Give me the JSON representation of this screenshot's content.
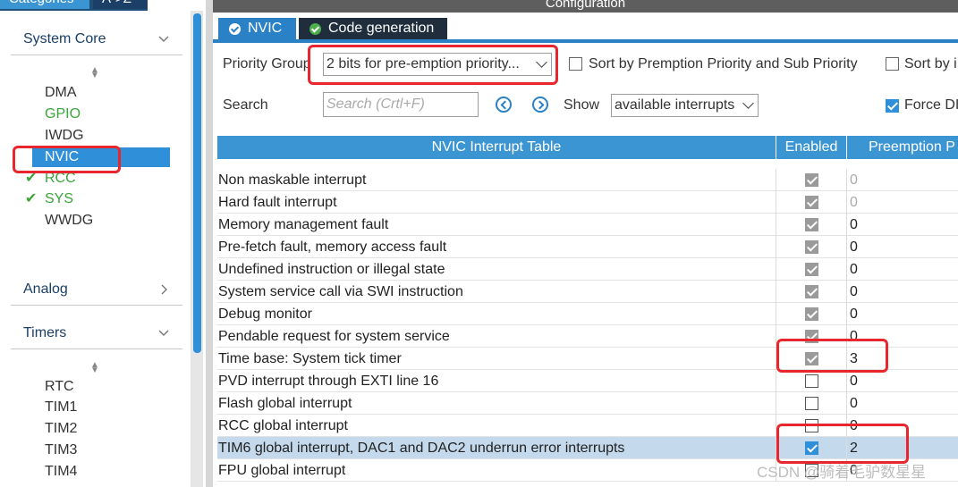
{
  "left_panel": {
    "tabs": {
      "categories": "Categories",
      "az": "A->Z"
    },
    "system_core": {
      "title": "System Core",
      "items": [
        {
          "label": "DMA",
          "state": "normal"
        },
        {
          "label": "GPIO",
          "state": "green"
        },
        {
          "label": "IWDG",
          "state": "normal"
        },
        {
          "label": "NVIC",
          "state": "selected"
        },
        {
          "label": "RCC",
          "state": "checked"
        },
        {
          "label": "SYS",
          "state": "checked"
        },
        {
          "label": "WWDG",
          "state": "normal"
        }
      ]
    },
    "analog": {
      "title": "Analog"
    },
    "timers": {
      "title": "Timers",
      "items": [
        "RTC",
        "TIM1",
        "TIM2",
        "TIM3",
        "TIM4"
      ]
    }
  },
  "right_panel": {
    "header_title": "Configuration",
    "tabs": {
      "nvic": "NVIC",
      "code_generation": "Code generation"
    },
    "priority_group": {
      "label": "Priority Group",
      "value": "2 bits for pre-emption priority..."
    },
    "sort_premption": "Sort by Premption Priority and Sub Priority",
    "sort_by": "Sort by i",
    "search": {
      "label": "Search",
      "placeholder": "Search (Crtl+F)"
    },
    "show": {
      "label": "Show",
      "value": "available interrupts"
    },
    "force": "Force DI",
    "table": {
      "headers": {
        "name": "NVIC Interrupt Table",
        "enabled": "Enabled",
        "preemption": "Preemption P"
      },
      "rows": [
        {
          "name": "Non maskable interrupt",
          "enabled": "grey",
          "priority": "0",
          "dim": true
        },
        {
          "name": "Hard fault interrupt",
          "enabled": "grey",
          "priority": "0",
          "dim": true
        },
        {
          "name": "Memory management fault",
          "enabled": "grey",
          "priority": "0",
          "dim": false
        },
        {
          "name": "Pre-fetch fault, memory access fault",
          "enabled": "grey",
          "priority": "0",
          "dim": false
        },
        {
          "name": "Undefined instruction or illegal state",
          "enabled": "grey",
          "priority": "0",
          "dim": false
        },
        {
          "name": "System service call via SWI instruction",
          "enabled": "grey",
          "priority": "0",
          "dim": false
        },
        {
          "name": "Debug monitor",
          "enabled": "grey",
          "priority": "0",
          "dim": false
        },
        {
          "name": "Pendable request for system service",
          "enabled": "grey",
          "priority": "0",
          "dim": false
        },
        {
          "name": "Time base: System tick timer",
          "enabled": "grey",
          "priority": "3",
          "dim": false
        },
        {
          "name": "PVD interrupt through EXTI line 16",
          "enabled": "none",
          "priority": "0",
          "dim": false
        },
        {
          "name": "Flash global interrupt",
          "enabled": "none",
          "priority": "0",
          "dim": false
        },
        {
          "name": "RCC global interrupt",
          "enabled": "none",
          "priority": "0",
          "dim": false
        },
        {
          "name": "TIM6 global interrupt, DAC1 and DAC2 underrun error interrupts",
          "enabled": "blue",
          "priority": "2",
          "dim": false,
          "selected": true
        },
        {
          "name": "FPU global interrupt",
          "enabled": "none",
          "priority": "0",
          "dim": false
        }
      ]
    }
  },
  "watermark": "CSDN @骑着毛驴数星星"
}
